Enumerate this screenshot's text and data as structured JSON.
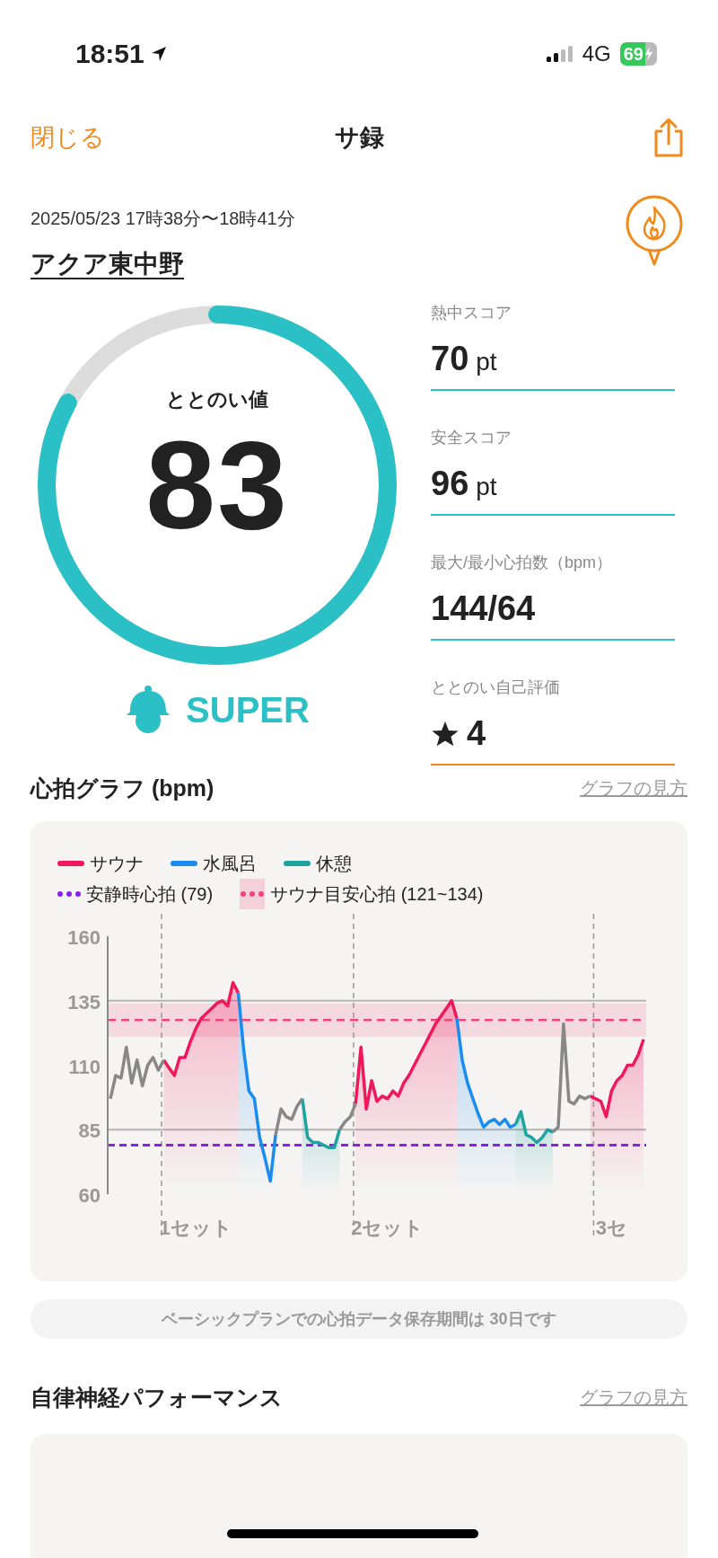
{
  "status_bar": {
    "time": "18:51",
    "network": "4G",
    "battery": "69"
  },
  "nav": {
    "close": "閉じる",
    "title": "サ録"
  },
  "session": {
    "datetime": "2025/05/23 17時38分〜18時41分",
    "venue": "アクア東中野"
  },
  "totonoi": {
    "label": "ととのい値",
    "value": "83",
    "level": 0.83,
    "rank": "SUPER"
  },
  "scores": [
    {
      "kind": "score",
      "label": "熱中スコア",
      "value": "70",
      "unit": "pt",
      "color": "#2bbfc6"
    },
    {
      "kind": "score",
      "label": "安全スコア",
      "value": "96",
      "unit": "pt",
      "color": "#2bbfc6"
    },
    {
      "kind": "score",
      "label": "最大/最小心拍数（bpm）",
      "value": "144/64",
      "color": "#2bbfc6"
    },
    {
      "kind": "rating",
      "label": "ととのい自己評価",
      "value": "4",
      "color": "#f08a1c"
    }
  ],
  "heart_graph": {
    "title": "心拍グラフ (bpm)",
    "help_link": "グラフの見方",
    "chart_data": {
      "type": "line",
      "yticks": [
        60,
        85,
        110,
        135,
        160
      ],
      "ylim": [
        60,
        160
      ],
      "categories": [
        null,
        null,
        null,
        null,
        null,
        null,
        null,
        null,
        null,
        null,
        null,
        null,
        null,
        null,
        null,
        null,
        "1セット",
        null,
        null,
        null,
        null,
        null,
        null,
        null,
        null,
        null,
        null,
        null,
        null,
        null,
        null,
        null,
        null,
        null,
        null,
        null,
        null,
        null,
        null,
        null,
        null,
        null,
        null,
        null,
        null,
        null,
        null,
        null,
        null,
        null,
        null,
        null,
        "2セット",
        null,
        null,
        null,
        null,
        null,
        null,
        null,
        null,
        null,
        null,
        null,
        null,
        null,
        null,
        null,
        null,
        null,
        null,
        null,
        null,
        null,
        null,
        null,
        null,
        null,
        null,
        null,
        null,
        null,
        null,
        null,
        null,
        null,
        null,
        null,
        null,
        null,
        null,
        null,
        null,
        null,
        "3セ",
        null,
        null,
        null,
        null,
        null,
        null
      ],
      "series": [
        {
          "name": "サウナ",
          "color": "#f0185a",
          "values": [
            null,
            null,
            null,
            null,
            null,
            null,
            null,
            null,
            null,
            null,
            112,
            109,
            106,
            113,
            113,
            119,
            124,
            128,
            130,
            132,
            134,
            135,
            133,
            142,
            138,
            null,
            null,
            null,
            null,
            null,
            null,
            null,
            null,
            null,
            null,
            null,
            null,
            null,
            null,
            null,
            null,
            null,
            null,
            null,
            null,
            null,
            95,
            117,
            93,
            104,
            96,
            98,
            97,
            100,
            98,
            103,
            106,
            110,
            114,
            118,
            122,
            126,
            129,
            132,
            135,
            128,
            null,
            null,
            null,
            null,
            null,
            null,
            null,
            null,
            null,
            null,
            null,
            null,
            null,
            null,
            null,
            null,
            null,
            null,
            null,
            null,
            null,
            null,
            null,
            null,
            98,
            97,
            96,
            90,
            100,
            104,
            106,
            110,
            110,
            114,
            120
          ]
        },
        {
          "name": "水風呂",
          "color": "#1a8cf0",
          "values": [
            null,
            null,
            null,
            null,
            null,
            null,
            null,
            null,
            null,
            null,
            null,
            null,
            null,
            null,
            null,
            null,
            null,
            null,
            null,
            null,
            null,
            null,
            null,
            null,
            138,
            116,
            100,
            97,
            82,
            74,
            65,
            83,
            null,
            null,
            null,
            null,
            null,
            null,
            null,
            null,
            null,
            null,
            null,
            null,
            null,
            null,
            null,
            null,
            null,
            null,
            null,
            null,
            null,
            null,
            null,
            null,
            null,
            null,
            null,
            null,
            null,
            null,
            null,
            null,
            null,
            128,
            112,
            103,
            97,
            91,
            86,
            88,
            89,
            87,
            89,
            86,
            87,
            null,
            null,
            null,
            null,
            null,
            null,
            null,
            null,
            null,
            null,
            null,
            null,
            null,
            null,
            null,
            null,
            null,
            null,
            null,
            null,
            null,
            null,
            null,
            null
          ]
        },
        {
          "name": "休憩",
          "color": "#1fa3a0",
          "values": [
            null,
            null,
            null,
            null,
            null,
            null,
            null,
            null,
            null,
            null,
            null,
            null,
            null,
            null,
            null,
            null,
            null,
            null,
            null,
            null,
            null,
            null,
            null,
            null,
            null,
            null,
            null,
            null,
            null,
            null,
            null,
            null,
            null,
            null,
            null,
            null,
            97,
            82,
            80,
            80,
            79,
            78,
            78,
            85,
            null,
            null,
            null,
            null,
            null,
            null,
            null,
            null,
            null,
            null,
            null,
            null,
            null,
            null,
            null,
            null,
            null,
            null,
            null,
            null,
            null,
            null,
            null,
            null,
            null,
            null,
            null,
            null,
            null,
            null,
            null,
            null,
            87,
            92,
            83,
            82,
            80,
            82,
            85,
            84,
            null,
            null,
            null,
            null,
            null,
            null,
            null,
            null,
            null,
            null,
            null,
            null,
            null,
            null,
            null,
            null,
            null
          ]
        },
        {
          "color": "#888888",
          "values": [
            97,
            106,
            105,
            117,
            103,
            112,
            102,
            110,
            113,
            108,
            112,
            null,
            null,
            null,
            null,
            null,
            null,
            null,
            null,
            null,
            null,
            null,
            null,
            null,
            null,
            null,
            null,
            null,
            null,
            null,
            null,
            83,
            93,
            90,
            89,
            94,
            97,
            null,
            null,
            null,
            null,
            null,
            null,
            85,
            88,
            90,
            95,
            null,
            null,
            null,
            null,
            null,
            null,
            null,
            null,
            null,
            null,
            null,
            null,
            null,
            null,
            null,
            null,
            null,
            null,
            null,
            null,
            null,
            null,
            null,
            null,
            null,
            null,
            null,
            null,
            null,
            null,
            null,
            null,
            null,
            null,
            null,
            null,
            84,
            86,
            126,
            96,
            95,
            98,
            97,
            98,
            null,
            null,
            null,
            null,
            null,
            null,
            null,
            null,
            null,
            null
          ]
        }
      ],
      "ref_lines": [
        {
          "axis": "y",
          "value": 79,
          "label": "安静時心拍 (79)",
          "color": "#8b1ff0"
        },
        {
          "axis": "y",
          "value": 127.5,
          "color": "#f0437a"
        }
      ],
      "bands": [
        {
          "axis": "y",
          "from": 121,
          "to": 134,
          "label": "サウナ目安心拍 (121~134)",
          "color": "#f0437a"
        }
      ]
    }
  },
  "notice": "ベーシックプランでの心拍データ保存期間は 30日です",
  "autonomic": {
    "title": "自律神経パフォーマンス",
    "help_link": "グラフの見方"
  }
}
